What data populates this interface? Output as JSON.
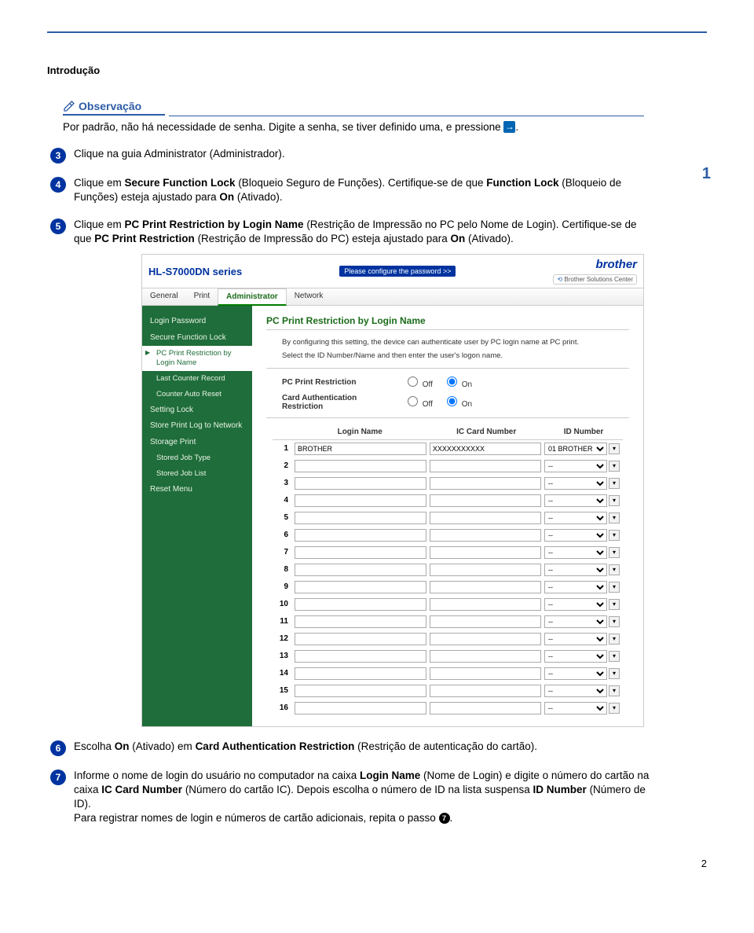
{
  "doc": {
    "section_title": "Introdução",
    "chapter_badge": "1",
    "page_number": "2"
  },
  "note": {
    "title": "Observação",
    "body": "Por padrão, não há necessidade de senha. Digite a senha, se tiver definido uma, e pressione"
  },
  "steps": {
    "s3": "Clique na guia Administrator (Administrador).",
    "s4a": "Clique em ",
    "s4b": "Secure Function Lock",
    "s4c": " (Bloqueio Seguro de Funções). Certifique-se de que ",
    "s4d": "Function Lock",
    "s4e": " (Bloqueio de Funções) esteja ajustado para ",
    "s4f": "On",
    "s4g": " (Ativado).",
    "s5a": "Clique em ",
    "s5b": "PC Print Restriction by Login Name",
    "s5c": " (Restrição de Impressão no PC pelo Nome de Login). Certifique-se de que ",
    "s5d": "PC Print Restriction",
    "s5e": " (Restrição de Impressão do PC) esteja ajustado para ",
    "s5f": "On",
    "s5g": " (Ativado).",
    "s6a": "Escolha ",
    "s6b": "On",
    "s6c": " (Ativado) em ",
    "s6d": "Card Authentication Restriction",
    "s6e": " (Restrição de autenticação do cartão).",
    "s7a": "Informe o nome de login do usuário no computador na caixa ",
    "s7b": "Login Name",
    "s7c": " (Nome de Login) e digite o número do cartão na caixa ",
    "s7d": "IC Card Number",
    "s7e": " (Número do cartão IC). Depois escolha o número de ID na lista suspensa ",
    "s7f": "ID Number",
    "s7g": " (Número de ID).",
    "s7h": "Para registrar nomes de login e números de cartão adicionais, repita o passo ",
    "s7i": "7",
    "s7j": "."
  },
  "shot": {
    "product": "HL-S7000DN series",
    "config_btn": "Please configure the password >>",
    "brand": "brother",
    "solutions": "Brother Solutions Center",
    "tabs": [
      "General",
      "Print",
      "Administrator",
      "Network"
    ],
    "sidebar": [
      {
        "label": "Login Password"
      },
      {
        "label": "Secure Function Lock"
      },
      {
        "label": "PC Print Restriction by Login Name",
        "sub": true,
        "selected": true
      },
      {
        "label": "Last Counter Record",
        "sub": true
      },
      {
        "label": "Counter Auto Reset",
        "sub": true
      },
      {
        "label": "Setting Lock"
      },
      {
        "label": "Store Print Log to Network"
      },
      {
        "label": "Storage Print"
      },
      {
        "label": "Stored Job Type",
        "sub": true
      },
      {
        "label": "Stored Job List",
        "sub": true
      },
      {
        "label": "Reset Menu"
      }
    ],
    "main_heading": "PC Print Restriction by Login Name",
    "desc1": "By configuring this setting, the device can authenticate user by PC login name at PC print.",
    "desc2": "Select the ID Number/Name and then enter the user's logon name.",
    "row_pc_label": "PC Print Restriction",
    "row_card_label": "Card Authentication Restriction",
    "off": "Off",
    "on": "On",
    "th_login": "Login Name",
    "th_card": "IC Card Number",
    "th_id": "ID Number",
    "row1": {
      "login": "BROTHER",
      "card": "XXXXXXXXXXX",
      "id": "01 BROTHER"
    },
    "empty_id": "--",
    "row_count": 16
  }
}
